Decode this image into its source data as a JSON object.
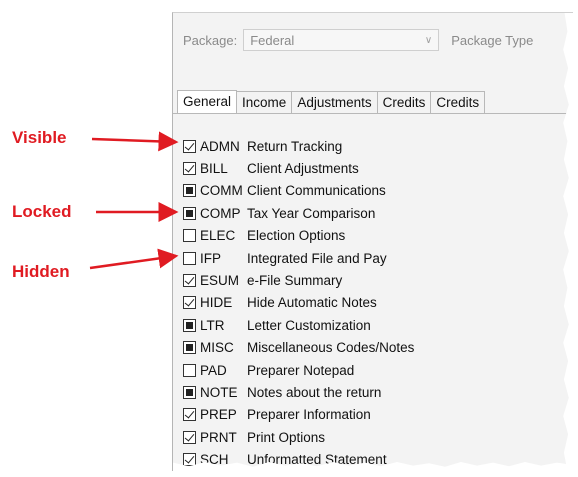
{
  "package": {
    "label": "Package:",
    "value": "Federal",
    "type_label": "Package Type"
  },
  "tabs": [
    "General",
    "Income",
    "Adjustments",
    "Credits",
    "Credits"
  ],
  "callouts": {
    "visible": "Visible",
    "locked": "Locked",
    "hidden": "Hidden"
  },
  "colors": {
    "callout": "#e01b22"
  },
  "items": [
    {
      "state": "checked",
      "code": "ADMN",
      "desc": "Return Tracking"
    },
    {
      "state": "checked",
      "code": "BILL",
      "desc": "Client Adjustments"
    },
    {
      "state": "locked",
      "code": "COMM",
      "desc": "Client Communications"
    },
    {
      "state": "locked",
      "code": "COMP",
      "desc": "Tax Year Comparison"
    },
    {
      "state": "empty",
      "code": "ELEC",
      "desc": "Election Options"
    },
    {
      "state": "empty",
      "code": "IFP",
      "desc": "Integrated File and Pay"
    },
    {
      "state": "checked",
      "code": "ESUM",
      "desc": "e-File Summary"
    },
    {
      "state": "checked",
      "code": "HIDE",
      "desc": "Hide Automatic Notes"
    },
    {
      "state": "locked",
      "code": "LTR",
      "desc": "Letter Customization"
    },
    {
      "state": "locked",
      "code": "MISC",
      "desc": "Miscellaneous Codes/Notes"
    },
    {
      "state": "empty",
      "code": "PAD",
      "desc": "Preparer Notepad"
    },
    {
      "state": "locked",
      "code": "NOTE",
      "desc": "Notes about the return"
    },
    {
      "state": "checked",
      "code": "PREP",
      "desc": "Preparer Information"
    },
    {
      "state": "checked",
      "code": "PRNT",
      "desc": "Print Options"
    },
    {
      "state": "checked",
      "code": "SCH",
      "desc": "Unformatted Statement"
    }
  ]
}
